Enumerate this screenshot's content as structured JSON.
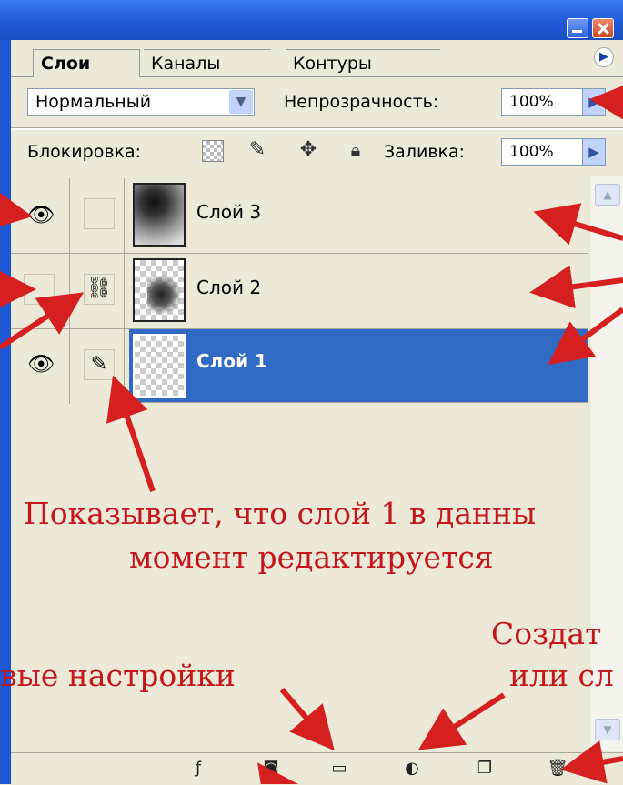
{
  "tabs": [
    "Слои",
    "Каналы",
    "Контуры"
  ],
  "blend_mode": {
    "value": "Нормальный"
  },
  "opacity": {
    "label": "Непрозрачность:",
    "value": "100%"
  },
  "lock": {
    "label": "Блокировка:"
  },
  "fill": {
    "label": "Заливка:",
    "value": "100%"
  },
  "layers": [
    {
      "name": "Слой 3",
      "visible": true,
      "link": "none"
    },
    {
      "name": "Слой 2",
      "visible": false,
      "link": "chain-icon"
    },
    {
      "name": "Слой 1",
      "visible": true,
      "link": "brush-icon",
      "selected": true
    }
  ],
  "annotations": {
    "edit_line1": "Показывает, что слой 1 в данны",
    "edit_line2": "момент редактируется",
    "settings_fragment": "вые настройки",
    "create_fragment1": "Создат",
    "create_fragment2": "или сл"
  },
  "colors": {
    "annotation": "#c4161c",
    "selection": "#316ac5",
    "titlebar": "#1e57d6"
  }
}
